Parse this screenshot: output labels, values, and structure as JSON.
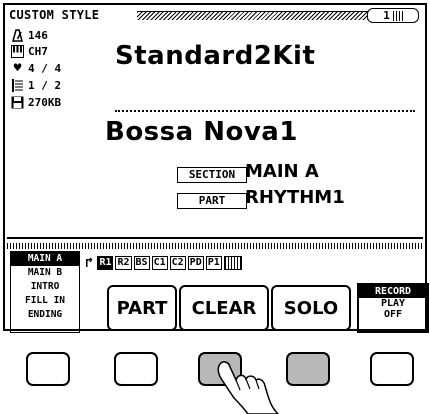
{
  "header": {
    "title": "CUSTOM STYLE",
    "page": "1"
  },
  "status": {
    "tempo": {
      "icon": "metronome-icon",
      "value": "146"
    },
    "channel": {
      "icon": "piano-keys-icon",
      "value": "CH7"
    },
    "time_signature": {
      "icon": "heart-icon",
      "value": "4 / 4"
    },
    "measure": {
      "icon": "measure-icon",
      "value": "1 / 2"
    },
    "memory": {
      "icon": "disk-icon",
      "value": "270KB"
    }
  },
  "style_name": "Standard2Kit",
  "variation_name": "Bossa Nova1",
  "section": {
    "label": "SECTION",
    "value": "MAIN A"
  },
  "part": {
    "label": "PART",
    "value": "RHYTHM1"
  },
  "section_list": [
    "MAIN A",
    "MAIN B",
    "INTRO",
    "FILL IN",
    "ENDING"
  ],
  "parts": [
    "R1",
    "R2",
    "BS",
    "C1",
    "C2",
    "PD",
    "P1"
  ],
  "buttons": {
    "part": "PART",
    "clear": "CLEAR",
    "solo": "SOLO"
  },
  "record": {
    "line1": "RECORD",
    "line2": "PLAY",
    "line3": "OFF"
  }
}
